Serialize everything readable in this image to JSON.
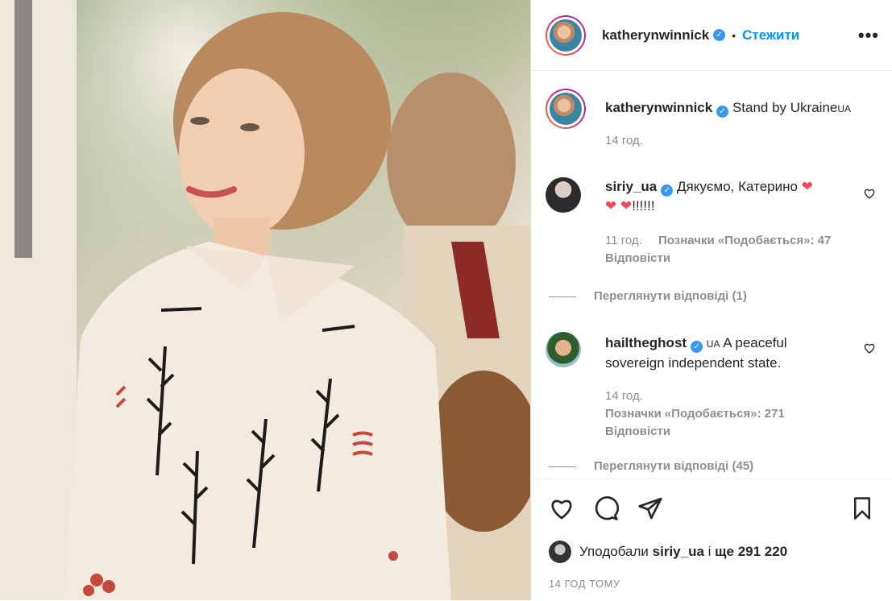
{
  "post": {
    "username": "katherynwinnick",
    "follow_label": "Стежити",
    "more_label": "•••"
  },
  "caption": {
    "username": "katherynwinnick",
    "text": "Stand by Ukraine",
    "flag_text": "UA",
    "time": "14 год."
  },
  "comments": [
    {
      "username": "siriy_ua",
      "text_line1": "Дякуємо, Катерино",
      "text_line2_suffix": "!!!!!!",
      "time": "11 год.",
      "likes_label": "Позначки «Подобається»: 47",
      "reply_label": "Відповісти",
      "view_replies": "Переглянути відповіді (1)"
    },
    {
      "username": "hailtheghost",
      "flag_text": "UA",
      "text_line1": "A peaceful",
      "text_line2": "sovereign independent state.",
      "time": "14 год.",
      "likes_label": "Позначки «Подобається»: 271",
      "reply_label": "Відповісти",
      "view_replies": "Переглянути відповіді (45)"
    }
  ],
  "footer": {
    "liked_by_prefix": "Уподобали",
    "liked_by_user": "siriy_ua",
    "liked_by_conj": "і",
    "liked_by_more": "ще 291 220",
    "time": "14 ГОД ТОМУ"
  },
  "icons": {
    "like": "heart-icon",
    "comment": "comment-icon",
    "share": "share-icon",
    "save": "bookmark-icon"
  },
  "colors": {
    "link_blue": "#0095f6",
    "verified_blue": "#3897f0",
    "muted": "#8e8e8e",
    "heart_red": "#ed4956"
  }
}
